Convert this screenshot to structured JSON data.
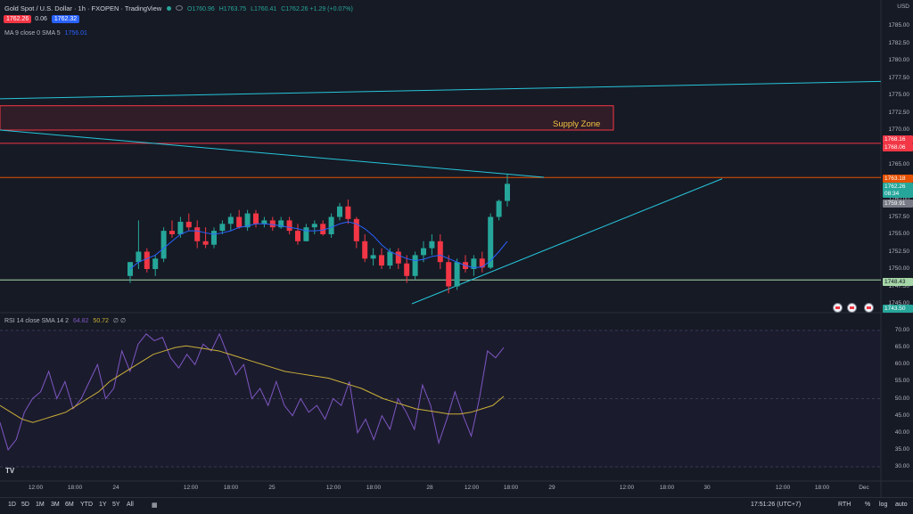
{
  "title": "Gold Spot / U.S. Dollar · 1h · FXOPEN · TradingView",
  "ohlc": {
    "o": "O1760.96",
    "h": "H1763.75",
    "l": "L1760.41",
    "c": "C1762.26 +1.29 (+0.07%)"
  },
  "price_box_sell": "1762.26",
  "spread": "0.06",
  "price_box_buy": "1762.32",
  "ma_legend": {
    "label": "MA 9 close 0 SMA 5",
    "value": "1756.01"
  },
  "rsi_legend": {
    "label": "RSI 14 close SMA 14 2",
    "v1": "64.82",
    "v2": "50.72",
    "v3": "∅ ∅"
  },
  "supply_zone_label": "Supply Zone",
  "price_axis": {
    "currency": "USD",
    "labels": [
      "1785.00",
      "1782.50",
      "1780.00",
      "1777.50",
      "1775.00",
      "1772.50",
      "1770.00",
      "1767.50",
      "1765.00",
      "1762.50",
      "1760.00",
      "1757.50",
      "1755.00",
      "1752.50",
      "1750.00",
      "1747.50",
      "1745.00"
    ]
  },
  "price_tags": {
    "t1": "1768.16",
    "t2": "1768.06",
    "t3": "1763.18",
    "current": "1762.26",
    "countdown": "08:34",
    "t5": "1759.91",
    "t6": "1748.43",
    "t7": "1743.50"
  },
  "rsi_axis": {
    "labels": [
      "70.00",
      "65.00",
      "60.00",
      "55.00",
      "50.00",
      "45.00",
      "40.00",
      "35.00",
      "30.00"
    ]
  },
  "time_axis": {
    "labels": [
      "12:00",
      "18:00",
      "24",
      "12:00",
      "18:00",
      "25",
      "12:00",
      "18:00",
      "28",
      "12:00",
      "18:00",
      "29",
      "12:00",
      "18:00",
      "30",
      "12:00",
      "18:00",
      "Dec"
    ]
  },
  "timeframes": [
    "1D",
    "5D",
    "1M",
    "3M",
    "6M",
    "YTD",
    "1Y",
    "5Y",
    "All"
  ],
  "status": {
    "time": "17:51:26 (UTC+7)",
    "session": "RTH",
    "percent": "%",
    "log": "log",
    "auto": "auto"
  },
  "tv_logo": "TV",
  "colors": {
    "up": "#26a69a",
    "down": "#f23645",
    "ma": "#2962ff",
    "rsi": "#7e57c2",
    "rsi_ma": "#c9b037",
    "trend": "#26c6da",
    "supply": "#f23645",
    "support": "#a5d6a7"
  },
  "chart_data": {
    "type": "candlestick",
    "interval": "1h",
    "candles": [
      [
        1749,
        1751,
        1748,
        1751
      ],
      [
        1751,
        1757,
        1750,
        1752.5
      ],
      [
        1752.5,
        1753,
        1749.5,
        1750
      ],
      [
        1750,
        1752,
        1749,
        1751.5
      ],
      [
        1751.5,
        1756,
        1751,
        1755.5
      ],
      [
        1755.5,
        1757,
        1754.5,
        1755
      ],
      [
        1755,
        1757.5,
        1754.5,
        1756.8
      ],
      [
        1756.8,
        1758,
        1755.5,
        1756
      ],
      [
        1756,
        1757,
        1753,
        1754
      ],
      [
        1754,
        1756,
        1753,
        1753.5
      ],
      [
        1753.5,
        1756,
        1753,
        1755.5
      ],
      [
        1755.5,
        1757,
        1755,
        1756.5
      ],
      [
        1756.5,
        1758,
        1755.5,
        1757.5
      ],
      [
        1757.5,
        1758.5,
        1755.8,
        1756
      ],
      [
        1756,
        1758.5,
        1755.5,
        1758
      ],
      [
        1758,
        1758.5,
        1756,
        1756.5
      ],
      [
        1756.5,
        1757.5,
        1756,
        1757
      ],
      [
        1757,
        1757.5,
        1755.5,
        1756
      ],
      [
        1756,
        1757.5,
        1755.8,
        1757
      ],
      [
        1757,
        1757.5,
        1755,
        1755.5
      ],
      [
        1755.5,
        1756.5,
        1753.5,
        1754
      ],
      [
        1754,
        1756.5,
        1754,
        1756
      ],
      [
        1756,
        1757,
        1755,
        1756.5
      ],
      [
        1756.5,
        1757,
        1754.8,
        1755
      ],
      [
        1755,
        1758,
        1754.5,
        1757.5
      ],
      [
        1757.5,
        1759.5,
        1757,
        1759
      ],
      [
        1759,
        1760,
        1756.5,
        1757.2
      ],
      [
        1757.2,
        1757.5,
        1753,
        1754
      ],
      [
        1754,
        1755,
        1751,
        1751.5
      ],
      [
        1751.5,
        1753,
        1750.5,
        1752
      ],
      [
        1752,
        1753,
        1750,
        1750.5
      ],
      [
        1750.5,
        1753,
        1750,
        1752.5
      ],
      [
        1752.5,
        1753,
        1750,
        1750.8
      ],
      [
        1750.8,
        1752,
        1748,
        1749
      ],
      [
        1749,
        1752.5,
        1748.5,
        1752
      ],
      [
        1752,
        1754,
        1751,
        1753
      ],
      [
        1753,
        1755,
        1752,
        1754
      ],
      [
        1754,
        1755,
        1750,
        1751
      ],
      [
        1751,
        1752,
        1746.5,
        1747.5
      ],
      [
        1747.5,
        1751.5,
        1747,
        1751
      ],
      [
        1751,
        1752,
        1749.5,
        1750
      ],
      [
        1750,
        1752,
        1749,
        1751.5
      ],
      [
        1751.5,
        1752.5,
        1749.5,
        1750.2
      ],
      [
        1750.2,
        1758,
        1750,
        1757.5
      ],
      [
        1757.5,
        1760,
        1757,
        1759.8
      ],
      [
        1759.8,
        1763.75,
        1759,
        1762.26
      ]
    ],
    "ma": [
      1750,
      1751,
      1751.5,
      1752,
      1753,
      1754,
      1755,
      1755.5,
      1755.5,
      1755.2,
      1755,
      1755.2,
      1755.5,
      1756,
      1756.2,
      1756.5,
      1756.5,
      1756.4,
      1756.2,
      1756,
      1755.8,
      1755.5,
      1755.5,
      1755.6,
      1756,
      1756.5,
      1756.8,
      1756.5,
      1755.8,
      1754.8,
      1753.5,
      1752.5,
      1752,
      1751.5,
      1751.2,
      1751.4,
      1751.8,
      1752,
      1751.5,
      1751,
      1750.5,
      1750.2,
      1750.3,
      1751.2,
      1752.5,
      1754
    ],
    "rsi": [
      43,
      35,
      38,
      46,
      50,
      52,
      58,
      50,
      55,
      47,
      50,
      55,
      60,
      50,
      53,
      64,
      58,
      66,
      69,
      67,
      68,
      62,
      59,
      63,
      60,
      66,
      64,
      69,
      63,
      57,
      60,
      50,
      53,
      48,
      55,
      48,
      45,
      50,
      46,
      48,
      44,
      50,
      48,
      55,
      40,
      44,
      38,
      45,
      41,
      50,
      46,
      41,
      54,
      48,
      37,
      44,
      52,
      45,
      39,
      50,
      64,
      62,
      65
    ],
    "rsi_ma": [
      48,
      46,
      44,
      43,
      44,
      45,
      46,
      48,
      50,
      52,
      55,
      57,
      59,
      61,
      63,
      64,
      65,
      65.5,
      65,
      64.5,
      64,
      63,
      62,
      61,
      60,
      59,
      58,
      57.5,
      57,
      56.5,
      56,
      55,
      54,
      53,
      51.5,
      50,
      49,
      48,
      47,
      46.5,
      46,
      45.5,
      45.5,
      46,
      47,
      48,
      50.7
    ],
    "trendlines": [
      {
        "p1": [
          0,
          1774.5
        ],
        "p2": [
          1,
          1777
        ]
      },
      {
        "p1": [
          0,
          1770
        ],
        "p2": [
          1,
          1763.2
        ]
      },
      {
        "p1": [
          0,
          1745
        ],
        "p2": [
          1,
          1763
        ]
      }
    ],
    "supply_zone": [
      1770,
      1773.5
    ],
    "support": 1748.43,
    "resistance": 1763.18
  }
}
